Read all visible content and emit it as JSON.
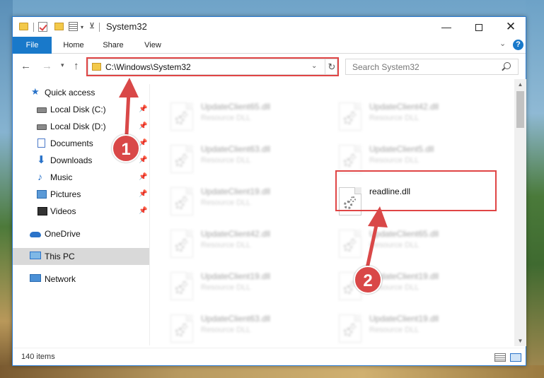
{
  "window": {
    "title": "System32",
    "controls": {
      "minimize": "—",
      "maximize": "",
      "close": "✕"
    }
  },
  "ribbon": {
    "tabs": [
      "File",
      "Home",
      "Share",
      "View"
    ]
  },
  "address": {
    "path": "C:\\Windows\\System32",
    "search_placeholder": "Search System32"
  },
  "sidebar": {
    "quick_access": "Quick access",
    "items": [
      {
        "label": "Local Disk (C:)",
        "icon": "drive-icon",
        "pinned": true
      },
      {
        "label": "Local Disk (D:)",
        "icon": "drive-icon",
        "pinned": true
      },
      {
        "label": "Documents",
        "icon": "documents-icon",
        "pinned": true
      },
      {
        "label": "Downloads",
        "icon": "downloads-icon",
        "pinned": true
      },
      {
        "label": "Music",
        "icon": "music-icon",
        "pinned": true
      },
      {
        "label": "Pictures",
        "icon": "pictures-icon",
        "pinned": true
      },
      {
        "label": "Videos",
        "icon": "videos-icon",
        "pinned": true
      }
    ],
    "onedrive": "OneDrive",
    "this_pc": "This PC",
    "network": "Network"
  },
  "files": [
    {
      "name": "UpdateClient65.dll",
      "type": "Resource DLL",
      "blurred": true
    },
    {
      "name": "UpdateClient42.dll",
      "type": "Resource DLL",
      "blurred": true
    },
    {
      "name": "UpdateClient63.dll",
      "type": "Resource DLL",
      "blurred": true
    },
    {
      "name": "UpdateClient5.dll",
      "type": "Resource DLL",
      "blurred": true
    },
    {
      "name": "UpdateClient19.dll",
      "type": "Resource DLL",
      "blurred": true
    },
    {
      "name": "readline.dll",
      "type": "",
      "blurred": false
    },
    {
      "name": "UpdateClient42.dll",
      "type": "Resource DLL",
      "blurred": true
    },
    {
      "name": "UpdateClient65.dll",
      "type": "Resource DLL",
      "blurred": true
    },
    {
      "name": "UpdateClient19.dll",
      "type": "Resource DLL",
      "blurred": true
    },
    {
      "name": "UpdateClient19.dll",
      "type": "Resource DLL",
      "blurred": true
    },
    {
      "name": "UpdateClient63.dll",
      "type": "Resource DLL",
      "blurred": true
    },
    {
      "name": "UpdateClient19.dll",
      "type": "Resource DLL",
      "blurred": true
    }
  ],
  "status": {
    "item_count": "140 items"
  },
  "annotations": {
    "step1": "1",
    "step2": "2",
    "highlight_color": "#e04545"
  },
  "colors": {
    "accent": "#1979ca",
    "selected_bg": "#d9d9d9"
  }
}
